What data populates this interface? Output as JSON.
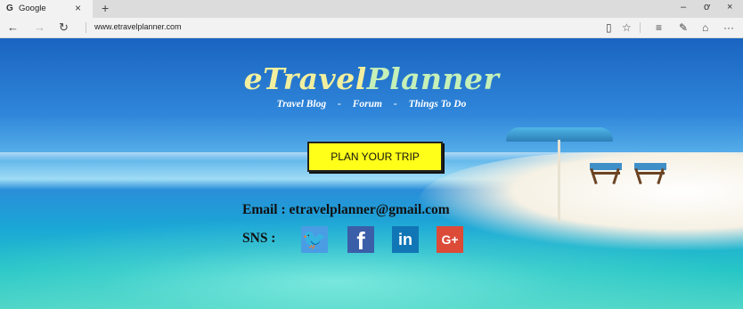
{
  "browser": {
    "tab": {
      "favicon": "G",
      "title": "Google",
      "close": "×"
    },
    "new_tab": "+",
    "window_controls": {
      "minimize": "–",
      "maximize": "ơ",
      "close": "×"
    },
    "nav": {
      "back": "←",
      "forward": "→",
      "refresh": "↻"
    },
    "url": "www.etravelplanner.com",
    "toolbar_icons": [
      "reading-view-icon",
      "favorites-star-icon",
      "hub-icon",
      "web-note-icon",
      "share-icon",
      "more-icon"
    ],
    "toolbar_glyphs": {
      "reading": "▯",
      "star": "☆",
      "hub": "≡",
      "note": "✎",
      "share": "⌂",
      "more": "···"
    }
  },
  "site": {
    "title_part1": "eTravel",
    "title_part2": "Planner",
    "nav": {
      "blog": "Travel Blog",
      "sep1": "-",
      "forum": "Forum",
      "sep2": "-",
      "things": "Things To Do"
    },
    "cta_label": "PLAN YOUR TRIP",
    "email_text": "Email : etravelplanner@gmail.com",
    "sns_label": "SNS :",
    "social": {
      "twitter": "🐦",
      "facebook": "f",
      "linkedin": "in",
      "gplus": "G+"
    }
  },
  "colors": {
    "cta_background": "#ffff19",
    "title": "#f3ec9a",
    "twitter": "#4a9de3",
    "facebook": "#3b5ea8",
    "linkedin": "#1176b6",
    "gplus": "#dc4a38"
  }
}
